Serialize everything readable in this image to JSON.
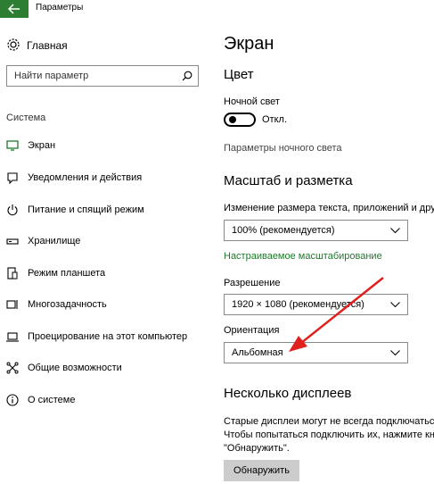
{
  "window": {
    "title": "Параметры"
  },
  "sidebar": {
    "home_label": "Главная",
    "search_placeholder": "Найти параметр",
    "section_label": "Система",
    "items": [
      {
        "label": "Экран",
        "icon": "monitor-icon",
        "active": true
      },
      {
        "label": "Уведомления и действия",
        "icon": "notification-icon"
      },
      {
        "label": "Питание и спящий режим",
        "icon": "power-icon"
      },
      {
        "label": "Хранилище",
        "icon": "storage-icon"
      },
      {
        "label": "Режим планшета",
        "icon": "tablet-icon"
      },
      {
        "label": "Многозадачность",
        "icon": "multitasking-icon"
      },
      {
        "label": "Проецирование на этот компьютер",
        "icon": "projecting-icon"
      },
      {
        "label": "Общие возможности",
        "icon": "shared-experiences-icon"
      },
      {
        "label": "О системе",
        "icon": "info-icon"
      }
    ]
  },
  "main": {
    "page_title": "Экран",
    "color_section": "Цвет",
    "night_light_label": "Ночной свет",
    "night_light_state": "Откл.",
    "night_light_settings_link": "Параметры ночного света",
    "scale_section": "Масштаб и разметка",
    "scale_label": "Изменение размера текста, приложений и других",
    "scale_value": "100% (рекомендуется)",
    "custom_scaling_link": "Настраиваемое масштабирование",
    "resolution_label": "Разрешение",
    "resolution_value": "1920 × 1080 (рекомендуется)",
    "orientation_label": "Ориентация",
    "orientation_value": "Альбомная",
    "multi_display_section": "Несколько дисплеев",
    "multi_display_desc_1": "Старые дисплеи могут не всегда подключаться",
    "multi_display_desc_2": "Чтобы попытаться подключить их, нажмите кнопку",
    "multi_display_desc_3": "\"Обнаружить\".",
    "detect_button": "Обнаружить"
  },
  "colors": {
    "accent": "#2d7d32",
    "link_green": "#1e7b2a",
    "annotation_arrow": "#e0201e"
  }
}
